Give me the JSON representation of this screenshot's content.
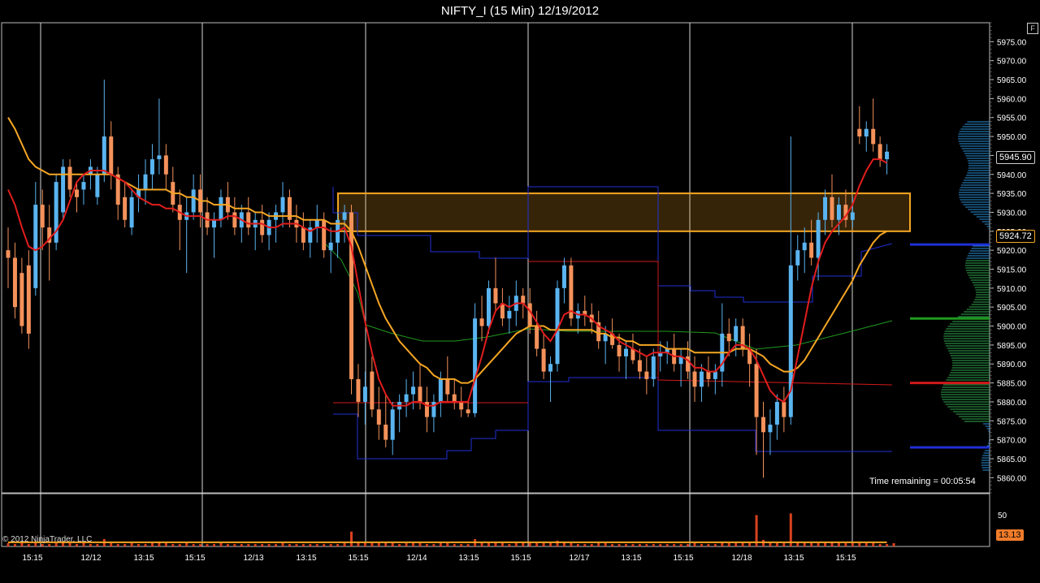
{
  "window": {
    "title": "NIFTY_I (15 Min)  12/19/2012",
    "corner_button": "F",
    "copyright": "© 2012 NinjaTrader, LLC",
    "time_remaining": "Time remaining = 00:05:54"
  },
  "badges": {
    "last_price": "5945.90",
    "sma_value": "5924.72",
    "volume_value": "13.13"
  },
  "chart_data": {
    "type": "candlestick",
    "title": "NIFTY_I (15 Min)  12/19/2012",
    "ylim": [
      5856,
      5980
    ],
    "y_ticks": [
      "5975.00",
      "5970.00",
      "5965.00",
      "5960.00",
      "5955.00",
      "5950.00",
      "5945.00",
      "5940.00",
      "5935.00",
      "5930.00",
      "5925.00",
      "5920.00",
      "5915.00",
      "5910.00",
      "5905.00",
      "5900.00",
      "5895.00",
      "5890.00",
      "5885.00",
      "5880.00",
      "5875.00",
      "5870.00",
      "5865.00",
      "5860.00"
    ],
    "x_ticks": [
      "15:15",
      "12/12",
      "13:15",
      "15:15",
      "12/13",
      "13:15",
      "15:15",
      "12/14",
      "13:15",
      "15:15",
      "12/17",
      "13:15",
      "15:15",
      "12/18",
      "13:15",
      "15:15"
    ],
    "volume_ticks": [
      "50"
    ],
    "colors": {
      "up": "#5ab4f0",
      "down": "#f4915a",
      "ema": "#e11d1d",
      "sma": "#f5a623",
      "grid": "#d8d8d8",
      "zone": "#f5a623",
      "vwap_blue": "#1f2fd6",
      "vwap_green": "#1f9a1f",
      "vwap_red": "#d11a1a"
    },
    "candles": [
      [
        5920,
        5926,
        5910,
        5918
      ],
      [
        5918,
        5922,
        5902,
        5905
      ],
      [
        5914,
        5918,
        5898,
        5900
      ],
      [
        5916,
        5920,
        5894,
        5898
      ],
      [
        5910,
        5938,
        5908,
        5932
      ],
      [
        5932,
        5936,
        5920,
        5926
      ],
      [
        5926,
        5932,
        5912,
        5922
      ],
      [
        5922,
        5940,
        5920,
        5938
      ],
      [
        5930,
        5944,
        5928,
        5942
      ],
      [
        5942,
        5944,
        5934,
        5936
      ],
      [
        5936,
        5938,
        5930,
        5934
      ],
      [
        5936,
        5940,
        5932,
        5938
      ],
      [
        5940,
        5944,
        5936,
        5942
      ],
      [
        5934,
        5942,
        5932,
        5940
      ],
      [
        5940,
        5965,
        5938,
        5950
      ],
      [
        5950,
        5954,
        5936,
        5940
      ],
      [
        5940,
        5942,
        5928,
        5932
      ],
      [
        5934,
        5938,
        5926,
        5928
      ],
      [
        5926,
        5936,
        5924,
        5934
      ],
      [
        5934,
        5940,
        5930,
        5936
      ],
      [
        5936,
        5944,
        5932,
        5940
      ],
      [
        5940,
        5948,
        5936,
        5944
      ],
      [
        5944,
        5960,
        5940,
        5945
      ],
      [
        5945,
        5948,
        5936,
        5940
      ],
      [
        5938,
        5942,
        5930,
        5932
      ],
      [
        5932,
        5936,
        5920,
        5928
      ],
      [
        5928,
        5934,
        5914,
        5930
      ],
      [
        5930,
        5940,
        5928,
        5936
      ],
      [
        5936,
        5940,
        5926,
        5930
      ],
      [
        5930,
        5934,
        5924,
        5926
      ],
      [
        5926,
        5930,
        5918,
        5928
      ],
      [
        5928,
        5936,
        5926,
        5934
      ],
      [
        5934,
        5938,
        5928,
        5930
      ],
      [
        5930,
        5934,
        5924,
        5926
      ],
      [
        5926,
        5932,
        5922,
        5930
      ],
      [
        5930,
        5934,
        5924,
        5926
      ],
      [
        5926,
        5930,
        5920,
        5928
      ],
      [
        5928,
        5932,
        5922,
        5924
      ],
      [
        5924,
        5930,
        5920,
        5928
      ],
      [
        5928,
        5932,
        5922,
        5930
      ],
      [
        5930,
        5938,
        5926,
        5934
      ],
      [
        5934,
        5936,
        5926,
        5928
      ],
      [
        5928,
        5932,
        5922,
        5926
      ],
      [
        5926,
        5930,
        5920,
        5922
      ],
      [
        5922,
        5928,
        5918,
        5926
      ],
      [
        5926,
        5932,
        5922,
        5928
      ],
      [
        5928,
        5930,
        5918,
        5920
      ],
      [
        5920,
        5926,
        5914,
        5922
      ],
      [
        5922,
        5930,
        5918,
        5928
      ],
      [
        5928,
        5932,
        5922,
        5930
      ],
      [
        5930,
        5932,
        5882,
        5886
      ],
      [
        5886,
        5890,
        5876,
        5880
      ],
      [
        5880,
        5888,
        5874,
        5884
      ],
      [
        5888,
        5892,
        5876,
        5878
      ],
      [
        5878,
        5884,
        5870,
        5874
      ],
      [
        5874,
        5882,
        5868,
        5870
      ],
      [
        5870,
        5880,
        5866,
        5878
      ],
      [
        5878,
        5882,
        5872,
        5880
      ],
      [
        5880,
        5886,
        5876,
        5882
      ],
      [
        5882,
        5888,
        5878,
        5884
      ],
      [
        5884,
        5890,
        5878,
        5880
      ],
      [
        5880,
        5884,
        5872,
        5876
      ],
      [
        5876,
        5882,
        5872,
        5880
      ],
      [
        5880,
        5888,
        5876,
        5886
      ],
      [
        5886,
        5892,
        5880,
        5882
      ],
      [
        5882,
        5886,
        5878,
        5880
      ],
      [
        5880,
        5884,
        5876,
        5878
      ],
      [
        5878,
        5880,
        5876,
        5877
      ],
      [
        5877,
        5906,
        5876,
        5902
      ],
      [
        5902,
        5908,
        5896,
        5900
      ],
      [
        5900,
        5912,
        5898,
        5910
      ],
      [
        5910,
        5918,
        5904,
        5906
      ],
      [
        5906,
        5910,
        5900,
        5902
      ],
      [
        5902,
        5908,
        5898,
        5904
      ],
      [
        5904,
        5912,
        5900,
        5908
      ],
      [
        5908,
        5910,
        5902,
        5906
      ],
      [
        5906,
        5910,
        5898,
        5900
      ],
      [
        5900,
        5904,
        5892,
        5894
      ],
      [
        5894,
        5898,
        5886,
        5888
      ],
      [
        5888,
        5892,
        5880,
        5890
      ],
      [
        5890,
        5912,
        5888,
        5910
      ],
      [
        5910,
        5918,
        5906,
        5916
      ],
      [
        5916,
        5918,
        5900,
        5902
      ],
      [
        5902,
        5906,
        5898,
        5904
      ],
      [
        5904,
        5908,
        5900,
        5903
      ],
      [
        5903,
        5906,
        5898,
        5901
      ],
      [
        5901,
        5904,
        5894,
        5896
      ],
      [
        5896,
        5900,
        5890,
        5898
      ],
      [
        5898,
        5902,
        5894,
        5895
      ],
      [
        5895,
        5898,
        5888,
        5892
      ],
      [
        5892,
        5896,
        5886,
        5894
      ],
      [
        5894,
        5898,
        5890,
        5891
      ],
      [
        5891,
        5894,
        5886,
        5888
      ],
      [
        5888,
        5892,
        5882,
        5886
      ],
      [
        5886,
        5894,
        5884,
        5892
      ],
      [
        5892,
        5896,
        5888,
        5893
      ],
      [
        5893,
        5896,
        5890,
        5894
      ],
      [
        5894,
        5898,
        5888,
        5890
      ],
      [
        5890,
        5894,
        5884,
        5892
      ],
      [
        5892,
        5896,
        5886,
        5888
      ],
      [
        5888,
        5892,
        5880,
        5884
      ],
      [
        5884,
        5890,
        5880,
        5888
      ],
      [
        5888,
        5892,
        5884,
        5886
      ],
      [
        5886,
        5890,
        5882,
        5888
      ],
      [
        5888,
        5906,
        5884,
        5898
      ],
      [
        5898,
        5902,
        5892,
        5896
      ],
      [
        5896,
        5902,
        5892,
        5900
      ],
      [
        5900,
        5902,
        5892,
        5894
      ],
      [
        5894,
        5898,
        5884,
        5890
      ],
      [
        5890,
        5894,
        5866,
        5876
      ],
      [
        5876,
        5880,
        5860,
        5872
      ],
      [
        5872,
        5878,
        5866,
        5874
      ],
      [
        5874,
        5882,
        5870,
        5880
      ],
      [
        5880,
        5884,
        5872,
        5876
      ],
      [
        5876,
        5950,
        5874,
        5916
      ],
      [
        5916,
        5924,
        5912,
        5920
      ],
      [
        5920,
        5926,
        5914,
        5922
      ],
      [
        5922,
        5928,
        5916,
        5918
      ],
      [
        5918,
        5930,
        5912,
        5928
      ],
      [
        5928,
        5936,
        5924,
        5934
      ],
      [
        5934,
        5940,
        5926,
        5928
      ],
      [
        5928,
        5934,
        5924,
        5932
      ],
      [
        5932,
        5936,
        5926,
        5928
      ],
      [
        5928,
        5934,
        5926,
        5930
      ],
      [
        5952,
        5958,
        5948,
        5950
      ],
      [
        5950,
        5954,
        5946,
        5952
      ],
      [
        5952,
        5960,
        5946,
        5948
      ],
      [
        5948,
        5950,
        5942,
        5944
      ],
      [
        5944,
        5948,
        5940,
        5946
      ]
    ],
    "ema": [
      5936,
      5932,
      5926,
      5921,
      5920,
      5921,
      5923,
      5925,
      5928,
      5933,
      5938,
      5940,
      5941,
      5941,
      5941,
      5940,
      5939,
      5938,
      5936,
      5934,
      5933,
      5932,
      5932,
      5931,
      5931,
      5930,
      5929,
      5929,
      5929,
      5928,
      5928,
      5928,
      5929,
      5929,
      5928,
      5927,
      5927,
      5927,
      5926,
      5926,
      5927,
      5927,
      5927,
      5926,
      5925,
      5926,
      5926,
      5925,
      5925,
      5926,
      5921,
      5911,
      5901,
      5893,
      5886,
      5882,
      5879,
      5879,
      5879,
      5880,
      5880,
      5879,
      5879,
      5880,
      5880,
      5880,
      5880,
      5880,
      5886,
      5892,
      5899,
      5904,
      5906,
      5905,
      5906,
      5906,
      5904,
      5901,
      5898,
      5896,
      5899,
      5903,
      5904,
      5903,
      5903,
      5902,
      5900,
      5899,
      5898,
      5896,
      5895,
      5894,
      5893,
      5892,
      5893,
      5893,
      5893,
      5892,
      5892,
      5891,
      5889,
      5889,
      5888,
      5888,
      5890,
      5893,
      5895,
      5895,
      5894,
      5891,
      5887,
      5883,
      5881,
      5880,
      5883,
      5892,
      5901,
      5910,
      5917,
      5922,
      5925,
      5927,
      5929,
      5932,
      5937,
      5941,
      5944,
      5944,
      5943
    ],
    "sma": [
      5955,
      5952,
      5948,
      5944,
      5942,
      5941,
      5940,
      5940,
      5940,
      5940,
      5940,
      5940,
      5940,
      5940,
      5940,
      5940,
      5939,
      5938,
      5937,
      5936,
      5936,
      5936,
      5936,
      5936,
      5935,
      5935,
      5934,
      5934,
      5933,
      5933,
      5932,
      5932,
      5932,
      5931,
      5931,
      5931,
      5930,
      5930,
      5929,
      5929,
      5929,
      5929,
      5929,
      5928,
      5928,
      5928,
      5928,
      5927,
      5927,
      5927,
      5925,
      5921,
      5916,
      5911,
      5906,
      5902,
      5899,
      5896,
      5894,
      5892,
      5890,
      5889,
      5887,
      5886,
      5886,
      5886,
      5885,
      5885,
      5886,
      5888,
      5890,
      5892,
      5894,
      5896,
      5898,
      5899,
      5900,
      5900,
      5900,
      5899,
      5899,
      5899,
      5899,
      5899,
      5899,
      5899,
      5898,
      5898,
      5897,
      5897,
      5896,
      5896,
      5895,
      5895,
      5895,
      5895,
      5894,
      5894,
      5894,
      5894,
      5893,
      5893,
      5893,
      5893,
      5893,
      5893,
      5894,
      5894,
      5894,
      5893,
      5892,
      5890,
      5889,
      5888,
      5888,
      5889,
      5891,
      5894,
      5897,
      5900,
      5903,
      5906,
      5909,
      5912,
      5916,
      5919,
      5922,
      5924,
      5925
    ],
    "zone": {
      "from": 5925,
      "to": 5935
    },
    "volume": [
      4,
      3,
      4,
      3,
      4,
      3,
      3,
      4,
      5,
      4,
      3,
      4,
      3,
      3,
      9,
      4,
      3,
      3,
      4,
      3,
      3,
      4,
      6,
      4,
      3,
      3,
      4,
      3,
      3,
      3,
      3,
      4,
      3,
      3,
      3,
      3,
      3,
      3,
      3,
      3,
      4,
      3,
      3,
      3,
      3,
      3,
      3,
      3,
      3,
      4,
      18,
      6,
      5,
      4,
      4,
      5,
      4,
      3,
      4,
      4,
      4,
      3,
      3,
      4,
      4,
      3,
      3,
      3,
      9,
      5,
      4,
      5,
      4,
      3,
      4,
      4,
      4,
      4,
      4,
      4,
      7,
      5,
      4,
      3,
      3,
      3,
      4,
      4,
      3,
      3,
      3,
      3,
      3,
      3,
      3,
      3,
      3,
      3,
      3,
      3,
      4,
      3,
      3,
      3,
      6,
      4,
      4,
      4,
      4,
      38,
      8,
      5,
      4,
      4,
      40,
      6,
      5,
      4,
      4,
      4,
      5,
      4,
      4,
      4,
      4,
      4,
      4,
      3,
      3,
      4
    ],
    "volume_sma": 5
  }
}
